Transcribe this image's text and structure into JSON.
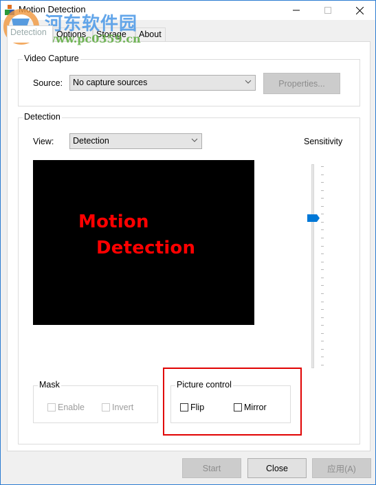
{
  "window": {
    "title": "Motion Detection",
    "app_icon": "app-icon",
    "controls": [
      "minimize-icon",
      "maximize-icon",
      "close-icon"
    ]
  },
  "watermark": {
    "brand": "河东软件园",
    "url": "www.pc0359.cn"
  },
  "tabs": [
    {
      "label": "Detection",
      "active": true
    },
    {
      "label": "Options",
      "active": false
    },
    {
      "label": "Storage",
      "active": false
    },
    {
      "label": "About",
      "active": false
    }
  ],
  "video_capture": {
    "group_label": "Video Capture",
    "source_label": "Source:",
    "source_value": "No capture sources",
    "properties_label": "Properties..."
  },
  "detection": {
    "group_label": "Detection",
    "view_label": "View:",
    "view_value": "Detection",
    "preview_line1": "Motion",
    "preview_line2": "Detection",
    "sensitivity_label": "Sensitivity",
    "sensitivity_value_fraction": 0.74,
    "sensitivity_ticks": 26
  },
  "mask": {
    "group_label": "Mask",
    "enable_label": "Enable",
    "enable_checked": false,
    "invert_label": "Invert",
    "invert_checked": false
  },
  "picture_control": {
    "group_label": "Picture control",
    "flip_label": "Flip",
    "flip_checked": false,
    "mirror_label": "Mirror",
    "mirror_checked": false
  },
  "footer": {
    "start_label": "Start",
    "close_label": "Close",
    "apply_label": "应用(A)"
  },
  "colors": {
    "accent": "#0078d7",
    "highlight": "#e00000",
    "preview_text": "#ff0000"
  }
}
